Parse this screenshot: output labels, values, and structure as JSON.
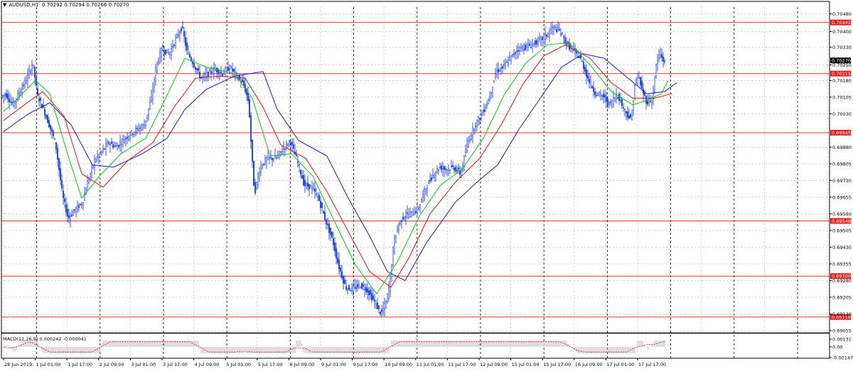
{
  "header": {
    "symbol_timeframe": "AUDUSD,H1",
    "ohlc": "0.70292 0.70294 0.70266 0.70270"
  },
  "macd_header": {
    "label": "MACD(12,26,9) 0.000242 -0.000041"
  },
  "colors": {
    "candles": "#2a4bd7",
    "ma_fast": "#11c911",
    "ma_mid": "#e01515",
    "ma_slow": "#1a1ad0",
    "sr_lines": "#e63333",
    "grid": "#c8c8c8",
    "day_separator": "#000000",
    "macd_hist": "#b8b8b8",
    "macd_signal": "#e01515",
    "price_tag_bg": "#e61e1e",
    "current_price_bg": "#000000"
  },
  "chart_data": {
    "type": "line",
    "instrument": "AUDUSD",
    "timeframe": "H1",
    "price_axis_ticks": [
      "0.70480",
      "0.70400",
      "0.70330",
      "0.70250",
      "0.70180",
      "0.70105",
      "0.70030",
      "0.69880",
      "0.69805",
      "0.69730",
      "0.69655",
      "0.69580",
      "0.69505",
      "0.69430",
      "0.69355",
      "0.69280",
      "0.69205",
      "0.69130",
      "0.69055"
    ],
    "ylim": [
      0.69055,
      0.7051
    ],
    "current_price": "0.70270",
    "support_resistance_levels": [
      "0.70441",
      "0.70211",
      "0.69945",
      "0.69548",
      "0.69300",
      "0.69116"
    ],
    "time_axis_labels": [
      "28 Jun 2019",
      "1 Jul 01:00",
      "1 Jul 17:00",
      "2 Jul 09:00",
      "3 Jul 01:00",
      "3 Jul 17:00",
      "4 Jul 09:00",
      "5 Jul 01:00",
      "5 Jul 17:00",
      "8 Jul 09:00",
      "9 Jul 01:00",
      "9 Jul 17:00",
      "10 Jul 09:00",
      "11 Jul 01:00",
      "11 Jul 17:00",
      "12 Jul 09:00",
      "15 Jul 01:00",
      "15 Jul 17:00",
      "16 Jul 09:00",
      "17 Jul 01:00",
      "17 Jul 17:00"
    ],
    "price_path": [
      [
        0,
        0.701
      ],
      [
        10,
        0.7012
      ],
      [
        20,
        0.7007
      ],
      [
        30,
        0.7013
      ],
      [
        40,
        0.7019
      ],
      [
        48,
        0.7026
      ],
      [
        55,
        0.7011
      ],
      [
        62,
        0.7006
      ],
      [
        70,
        0.6999
      ],
      [
        80,
        0.699
      ],
      [
        90,
        0.6966
      ],
      [
        98,
        0.6956
      ],
      [
        108,
        0.696
      ],
      [
        118,
        0.6963
      ],
      [
        125,
        0.6972
      ],
      [
        135,
        0.6982
      ],
      [
        145,
        0.6986
      ],
      [
        155,
        0.699
      ],
      [
        165,
        0.6988
      ],
      [
        175,
        0.6991
      ],
      [
        185,
        0.6994
      ],
      [
        195,
        0.6996
      ],
      [
        205,
        0.6998
      ],
      [
        215,
        0.701
      ],
      [
        222,
        0.7025
      ],
      [
        230,
        0.7032
      ],
      [
        240,
        0.703
      ],
      [
        250,
        0.7037
      ],
      [
        258,
        0.7042
      ],
      [
        265,
        0.7031
      ],
      [
        275,
        0.7025
      ],
      [
        285,
        0.7019
      ],
      [
        295,
        0.7021
      ],
      [
        305,
        0.7023
      ],
      [
        315,
        0.7021
      ],
      [
        325,
        0.7024
      ],
      [
        335,
        0.702
      ],
      [
        345,
        0.7016
      ],
      [
        352,
        0.7008
      ],
      [
        356,
        0.6985
      ],
      [
        360,
        0.6967
      ],
      [
        368,
        0.6979
      ],
      [
        378,
        0.6983
      ],
      [
        390,
        0.6983
      ],
      [
        400,
        0.6987
      ],
      [
        410,
        0.6991
      ],
      [
        420,
        0.6982
      ],
      [
        430,
        0.6971
      ],
      [
        440,
        0.697
      ],
      [
        450,
        0.6965
      ],
      [
        460,
        0.6955
      ],
      [
        470,
        0.6946
      ],
      [
        478,
        0.6935
      ],
      [
        488,
        0.6925
      ],
      [
        498,
        0.6924
      ],
      [
        508,
        0.6926
      ],
      [
        518,
        0.6924
      ],
      [
        528,
        0.6919
      ],
      [
        538,
        0.6913
      ],
      [
        545,
        0.6918
      ],
      [
        550,
        0.6926
      ],
      [
        556,
        0.6945
      ],
      [
        562,
        0.6953
      ],
      [
        570,
        0.6957
      ],
      [
        580,
        0.6958
      ],
      [
        590,
        0.696
      ],
      [
        600,
        0.6969
      ],
      [
        610,
        0.6975
      ],
      [
        620,
        0.6979
      ],
      [
        630,
        0.6978
      ],
      [
        640,
        0.6979
      ],
      [
        650,
        0.6976
      ],
      [
        660,
        0.699
      ],
      [
        670,
        0.6998
      ],
      [
        680,
        0.7003
      ],
      [
        690,
        0.701
      ],
      [
        700,
        0.7022
      ],
      [
        710,
        0.7024
      ],
      [
        720,
        0.7028
      ],
      [
        730,
        0.7032
      ],
      [
        740,
        0.7033
      ],
      [
        750,
        0.7034
      ],
      [
        760,
        0.7036
      ],
      [
        770,
        0.7038
      ],
      [
        780,
        0.7042
      ],
      [
        790,
        0.704
      ],
      [
        800,
        0.7034
      ],
      [
        810,
        0.7031
      ],
      [
        820,
        0.7027
      ],
      [
        830,
        0.7018
      ],
      [
        840,
        0.7012
      ],
      [
        850,
        0.7011
      ],
      [
        860,
        0.7007
      ],
      [
        870,
        0.7012
      ],
      [
        880,
        0.7005
      ],
      [
        890,
        0.7
      ],
      [
        895,
        0.7016
      ],
      [
        900,
        0.702
      ],
      [
        905,
        0.7014
      ],
      [
        912,
        0.7008
      ],
      [
        920,
        0.701
      ],
      [
        925,
        0.7025
      ],
      [
        930,
        0.703
      ],
      [
        935,
        0.7027
      ]
    ],
    "ma_fast_path": [
      [
        5,
        0.7004
      ],
      [
        25,
        0.701
      ],
      [
        50,
        0.7018
      ],
      [
        70,
        0.7012
      ],
      [
        95,
        0.6985
      ],
      [
        115,
        0.6965
      ],
      [
        140,
        0.6975
      ],
      [
        170,
        0.6985
      ],
      [
        205,
        0.6992
      ],
      [
        230,
        0.7008
      ],
      [
        260,
        0.7028
      ],
      [
        290,
        0.7024
      ],
      [
        330,
        0.7021
      ],
      [
        355,
        0.701
      ],
      [
        380,
        0.6984
      ],
      [
        410,
        0.6985
      ],
      [
        440,
        0.6975
      ],
      [
        470,
        0.6955
      ],
      [
        500,
        0.6935
      ],
      [
        530,
        0.6922
      ],
      [
        560,
        0.6937
      ],
      [
        590,
        0.6957
      ],
      [
        620,
        0.6971
      ],
      [
        650,
        0.6978
      ],
      [
        680,
        0.6992
      ],
      [
        710,
        0.7012
      ],
      [
        740,
        0.7026
      ],
      [
        770,
        0.7034
      ],
      [
        800,
        0.7035
      ],
      [
        830,
        0.7025
      ],
      [
        860,
        0.7013
      ],
      [
        890,
        0.7007
      ],
      [
        910,
        0.7009
      ],
      [
        930,
        0.7012
      ],
      [
        940,
        0.7018
      ]
    ],
    "ma_mid_path": [
      [
        5,
        0.7
      ],
      [
        30,
        0.7006
      ],
      [
        60,
        0.7013
      ],
      [
        90,
        0.7002
      ],
      [
        115,
        0.6976
      ],
      [
        145,
        0.697
      ],
      [
        180,
        0.6982
      ],
      [
        215,
        0.699
      ],
      [
        245,
        0.7006
      ],
      [
        275,
        0.7019
      ],
      [
        310,
        0.702
      ],
      [
        345,
        0.7019
      ],
      [
        370,
        0.7006
      ],
      [
        395,
        0.6989
      ],
      [
        430,
        0.6983
      ],
      [
        460,
        0.6968
      ],
      [
        490,
        0.695
      ],
      [
        520,
        0.6932
      ],
      [
        550,
        0.6925
      ],
      [
        575,
        0.6938
      ],
      [
        605,
        0.6958
      ],
      [
        640,
        0.6972
      ],
      [
        675,
        0.6983
      ],
      [
        705,
        0.6998
      ],
      [
        735,
        0.7016
      ],
      [
        765,
        0.7029
      ],
      [
        795,
        0.7034
      ],
      [
        830,
        0.7028
      ],
      [
        860,
        0.7017
      ],
      [
        890,
        0.701
      ],
      [
        920,
        0.701
      ],
      [
        945,
        0.7012
      ]
    ],
    "ma_slow_path": [
      [
        5,
        0.6995
      ],
      [
        40,
        0.7003
      ],
      [
        70,
        0.7008
      ],
      [
        100,
        0.6998
      ],
      [
        130,
        0.698
      ],
      [
        160,
        0.6979
      ],
      [
        200,
        0.6985
      ],
      [
        235,
        0.6992
      ],
      [
        260,
        0.7005
      ],
      [
        290,
        0.7014
      ],
      [
        330,
        0.702
      ],
      [
        370,
        0.7022
      ],
      [
        390,
        0.7005
      ],
      [
        420,
        0.6991
      ],
      [
        460,
        0.6984
      ],
      [
        490,
        0.6965
      ],
      [
        520,
        0.6948
      ],
      [
        545,
        0.6932
      ],
      [
        570,
        0.6928
      ],
      [
        600,
        0.6945
      ],
      [
        640,
        0.6963
      ],
      [
        670,
        0.6972
      ],
      [
        700,
        0.698
      ],
      [
        730,
        0.6996
      ],
      [
        760,
        0.701
      ],
      [
        790,
        0.7024
      ],
      [
        820,
        0.703
      ],
      [
        850,
        0.7028
      ],
      [
        880,
        0.702
      ],
      [
        910,
        0.7012
      ],
      [
        935,
        0.7013
      ],
      [
        952,
        0.7017
      ]
    ]
  }
}
